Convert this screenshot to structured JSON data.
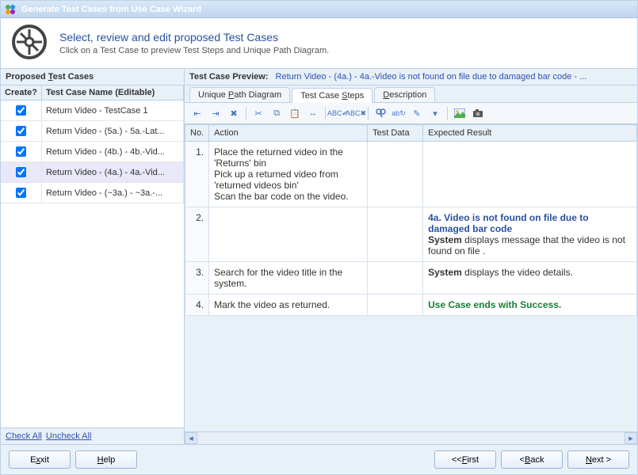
{
  "title": "Generate Test Cases from Use Case Wizard",
  "header": {
    "title": "Select, review and edit proposed Test Cases",
    "desc": "Click on a Test Case to preview Test Steps and Unique Path Diagram."
  },
  "left": {
    "panel_title_pre": "Proposed ",
    "panel_title_u": "T",
    "panel_title_post": "est Cases",
    "col_create": "Create?",
    "col_name": "Test Case Name (Editable)",
    "rows": [
      {
        "checked": true,
        "name": "Return Video - TestCase 1",
        "selected": false
      },
      {
        "checked": true,
        "name": "Return Video - (5a.) - 5a.-Lat...",
        "selected": false
      },
      {
        "checked": true,
        "name": "Return Video - (4b.) - 4b.-Vid...",
        "selected": false
      },
      {
        "checked": true,
        "name": "Return Video - (4a.) - 4a.-Vid...",
        "selected": true
      },
      {
        "checked": true,
        "name": "Return Video - (~3a.) - ~3a.-...",
        "selected": false
      }
    ],
    "check_all": "Check All",
    "uncheck_all": "Uncheck All"
  },
  "preview": {
    "label": "Test Case Preview:",
    "value": "Return Video - (4a.) - 4a.-Video is not found on file due to damaged bar code - ..."
  },
  "tabs": {
    "path": {
      "pre": "Unique ",
      "u": "P",
      "post": "ath Diagram"
    },
    "steps": {
      "pre": "Test Case ",
      "u": "S",
      "post": "teps"
    },
    "desc": {
      "u": "D",
      "post": "escription"
    }
  },
  "steps": {
    "col_no": "No.",
    "col_action": "Action",
    "col_testdata": "Test Data",
    "col_expected": "Expected Result",
    "rows": [
      {
        "no": "1.",
        "action": "Place the returned video in the 'Returns' bin\nPick up a returned video from 'returned videos bin'\nScan the bar code on the video.",
        "testdata": "",
        "expected_blue": "",
        "expected_bold": "",
        "expected_plain": "",
        "expected_green": ""
      },
      {
        "no": "2.",
        "action": "",
        "testdata": "",
        "expected_blue": "4a. Video is not found on file due to damaged bar code",
        "expected_bold": "System",
        "expected_plain": " displays message that the video is not found on file .",
        "expected_green": ""
      },
      {
        "no": "3.",
        "action": "Search for the video title in the system.",
        "testdata": "",
        "expected_blue": "",
        "expected_bold": "System",
        "expected_plain": " displays the video details.",
        "expected_green": ""
      },
      {
        "no": "4.",
        "action": "Mark the video as returned.",
        "testdata": "",
        "expected_blue": "",
        "expected_bold": "",
        "expected_plain": "",
        "expected_green": "Use Case ends with Success."
      }
    ]
  },
  "footer": {
    "exit": "xit",
    "help": "elp",
    "first": "irst",
    "back": "ack",
    "next": "ext >"
  }
}
